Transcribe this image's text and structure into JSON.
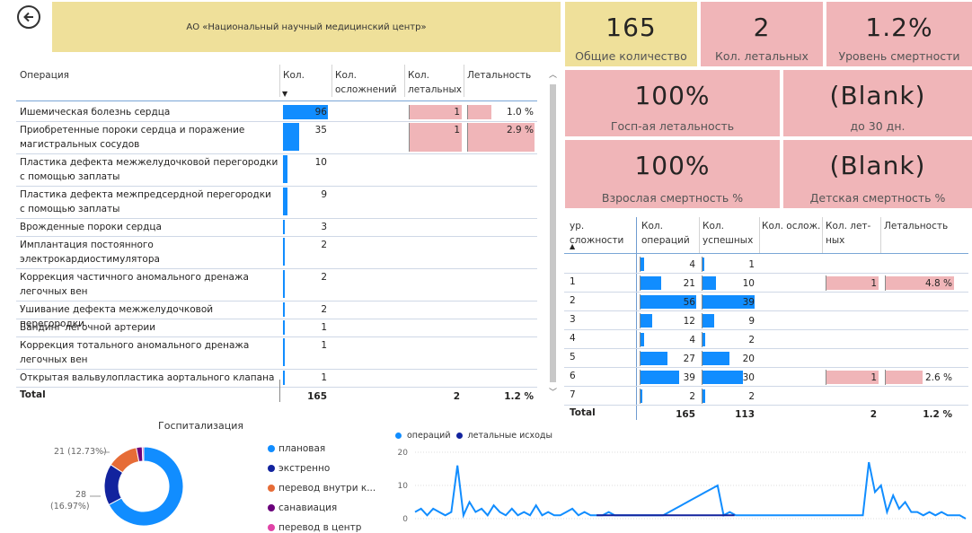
{
  "header": {
    "title": "АО «Национальный научный медицинский центр»"
  },
  "operations_table": {
    "columns": [
      "Операция",
      "Кол.",
      "Кол. осложнений",
      "Кол. летальных",
      "Летальность"
    ],
    "rows": [
      {
        "name": "Ишемическая болезнь сердца",
        "count": "96",
        "lethal": "1",
        "rate": "1.0 %",
        "count_val": 96,
        "lethal_val": 1,
        "rate_val": 1.0
      },
      {
        "name": "Приобретенные пороки сердца и поражение магистральных сосудов",
        "count": "35",
        "lethal": "1",
        "rate": "2.9 %",
        "count_val": 35,
        "lethal_val": 1,
        "rate_val": 2.9
      },
      {
        "name": "Пластика дефекта межжелудочковой перегородки с помощью заплаты",
        "count": "10",
        "lethal": "",
        "rate": "",
        "count_val": 10
      },
      {
        "name": "Пластика дефекта межпредсердной перегородки с помощью заплаты",
        "count": "9",
        "lethal": "",
        "rate": "",
        "count_val": 9
      },
      {
        "name": "Врожденные пороки сердца",
        "count": "3",
        "lethal": "",
        "rate": "",
        "count_val": 3
      },
      {
        "name": "Имплантация постоянного электрокардиостимулятора",
        "count": "2",
        "lethal": "",
        "rate": "",
        "count_val": 2
      },
      {
        "name": "Коррекция частичного аномального дренажа легочных вен",
        "count": "2",
        "lethal": "",
        "rate": "",
        "count_val": 2
      },
      {
        "name": "Ушивание дефекта межжелудочковой перегородки",
        "count": "2",
        "lethal": "",
        "rate": "",
        "count_val": 2
      },
      {
        "name": "Бандинг легочной артерии",
        "count": "1",
        "lethal": "",
        "rate": "",
        "count_val": 1
      },
      {
        "name": "Коррекция тотального аномального дренажа легочных вен",
        "count": "1",
        "lethal": "",
        "rate": "",
        "count_val": 1
      },
      {
        "name": "Открытая вальвулопластика аортального клапана",
        "count": "1",
        "lethal": "",
        "rate": "",
        "count_val": 1
      }
    ],
    "total": {
      "label": "Total",
      "count": "165",
      "lethal": "2",
      "rate": "1.2 %"
    }
  },
  "kpis": {
    "total_count": {
      "value": "165",
      "label": "Общие количество"
    },
    "lethal_count": {
      "value": "2",
      "label": "Кол. летальных"
    },
    "mortality_level": {
      "value": "1.2%",
      "label": "Уровень смертности"
    },
    "hosp_lethality": {
      "value": "100%",
      "label": "Госп-ая летальность"
    },
    "till_30": {
      "value": "(Blank)",
      "label": "до 30 дн."
    },
    "adult_mortality": {
      "value": "100%",
      "label": "Взрослая смертность %"
    },
    "child_mortality": {
      "value": "(Blank)",
      "label": "Детская смертность %"
    }
  },
  "complexity_table": {
    "columns": [
      "ур. сложности",
      "Кол. операций",
      "Кол. успешных",
      "Кол. ослож.",
      "Кол. лет-ных",
      "Летальность"
    ],
    "rows": [
      {
        "level": "",
        "ops": "4",
        "success": "1",
        "lethal": "",
        "rate": "",
        "ops_val": 4,
        "success_val": 1
      },
      {
        "level": "1",
        "ops": "21",
        "success": "10",
        "lethal": "1",
        "rate": "4.8 %",
        "ops_val": 21,
        "success_val": 10,
        "lethal_val": 1,
        "rate_val": 4.8
      },
      {
        "level": "2",
        "ops": "56",
        "success": "39",
        "lethal": "",
        "rate": "",
        "ops_val": 56,
        "success_val": 39
      },
      {
        "level": "3",
        "ops": "12",
        "success": "9",
        "lethal": "",
        "rate": "",
        "ops_val": 12,
        "success_val": 9
      },
      {
        "level": "4",
        "ops": "4",
        "success": "2",
        "lethal": "",
        "rate": "",
        "ops_val": 4,
        "success_val": 2
      },
      {
        "level": "5",
        "ops": "27",
        "success": "20",
        "lethal": "",
        "rate": "",
        "ops_val": 27,
        "success_val": 20
      },
      {
        "level": "6",
        "ops": "39",
        "success": "30",
        "lethal": "1",
        "rate": "2.6 %",
        "ops_val": 39,
        "success_val": 30,
        "lethal_val": 1,
        "rate_val": 2.6
      },
      {
        "level": "7",
        "ops": "2",
        "success": "2",
        "lethal": "",
        "rate": "",
        "ops_val": 2,
        "success_val": 2
      }
    ],
    "total": {
      "label": "Total",
      "ops": "165",
      "success": "113",
      "lethal": "2",
      "rate": "1.2 %"
    }
  },
  "hospitalization": {
    "title": "Госпитализация",
    "label_a": "21 (12.73%)",
    "label_b_count": "28",
    "label_b_pct": "(16.97%)",
    "legend": [
      {
        "label": "плановая",
        "color": "#118dff"
      },
      {
        "label": "экстренно",
        "color": "#12239e"
      },
      {
        "label": "перевод внутри к...",
        "color": "#e66c37"
      },
      {
        "label": "санавиация",
        "color": "#6b007b"
      },
      {
        "label": "перевод в центр",
        "color": "#e044a7"
      }
    ],
    "chart_data": {
      "type": "pie",
      "categories": [
        "плановая",
        "экстренно",
        "перевод внутри к...",
        "санавиация",
        "перевод в центр"
      ],
      "values": [
        111,
        28,
        21,
        4,
        1
      ]
    }
  },
  "timeline": {
    "legend": [
      {
        "label": "операций",
        "color": "#118dff"
      },
      {
        "label": "летальные исходы",
        "color": "#12239e"
      }
    ],
    "chart_data": {
      "type": "line",
      "yticks": [
        "20",
        "10",
        "0"
      ],
      "ylim": [
        0,
        20
      ],
      "series": [
        {
          "name": "операций",
          "values": [
            2,
            3,
            1,
            3,
            2,
            1,
            2,
            16,
            1,
            5,
            2,
            3,
            1,
            4,
            2,
            1,
            3,
            1,
            2,
            1,
            4,
            1,
            2,
            1,
            1,
            2,
            3,
            1,
            2,
            1,
            1,
            1,
            2,
            1,
            1,
            1,
            1,
            1,
            1,
            1,
            1,
            1,
            2,
            3,
            4,
            5,
            6,
            7,
            8,
            9,
            10,
            1,
            2,
            1,
            1,
            1,
            1,
            1,
            1,
            1,
            1,
            1,
            1,
            1,
            1,
            1,
            1,
            1,
            1,
            1,
            1,
            1,
            1,
            1,
            1,
            17,
            8,
            10,
            2,
            7,
            3,
            5,
            2,
            2,
            1,
            2,
            1,
            2,
            1,
            1,
            1,
            0
          ]
        },
        {
          "name": "летальные исходы",
          "values": [
            1,
            1,
            1,
            1,
            1,
            1,
            1,
            1,
            1,
            1,
            1,
            1,
            1,
            1,
            1,
            1,
            1,
            1,
            1,
            1,
            1
          ]
        }
      ]
    }
  }
}
